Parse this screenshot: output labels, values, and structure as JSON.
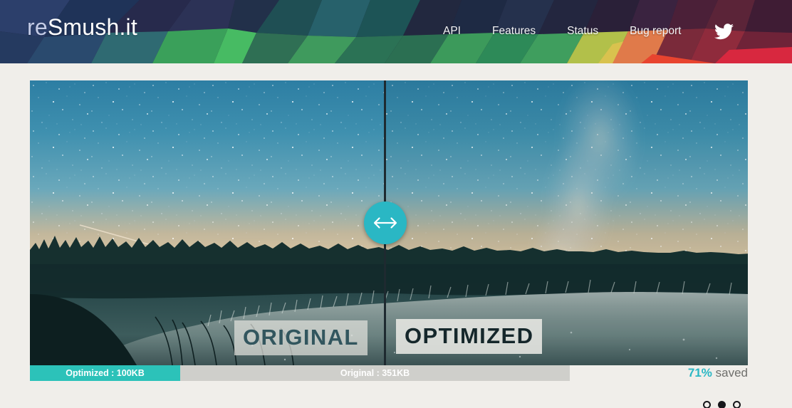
{
  "header": {
    "logo": {
      "prefix": "re",
      "suffix": "Smush.it",
      "full": "reSmush.it"
    },
    "nav": [
      {
        "label": "API",
        "name": "nav-link-api"
      },
      {
        "label": "Features",
        "name": "nav-link-features"
      },
      {
        "label": "Status",
        "name": "nav-link-status"
      },
      {
        "label": "Bug report",
        "name": "nav-link-bug-report"
      }
    ],
    "social": {
      "icon": "twitter-icon",
      "label": "Twitter"
    }
  },
  "comparison": {
    "photo_description": "Starry night sky with Milky Way over a silhouetted pine forest and reflective lake",
    "handle_icon": "left-right-arrow-icon",
    "divider_position_percent": 49,
    "labels": {
      "original": "ORIGINAL",
      "optimized": "OPTIMIZED"
    },
    "size_bar": {
      "optimized_label": "Optimized : 100KB",
      "original_label": "Original : 351KB",
      "optimized_size_kb": 100,
      "original_size_kb": 351,
      "optimized_color": "#2cc2b9",
      "original_color": "#cfcfcb"
    },
    "saved": {
      "percent": "71%",
      "word": "saved",
      "accent_color": "#2ab7c4"
    }
  },
  "carousel": {
    "slides": [
      {
        "name": "carousel-dot-1",
        "active": false
      },
      {
        "name": "carousel-dot-2",
        "active": true
      },
      {
        "name": "carousel-dot-3",
        "active": false
      }
    ],
    "active_index": 1
  },
  "theme": {
    "page_background": "#f0eeea",
    "accent": "#2ab7c4",
    "header_dark": "#2b2140"
  }
}
